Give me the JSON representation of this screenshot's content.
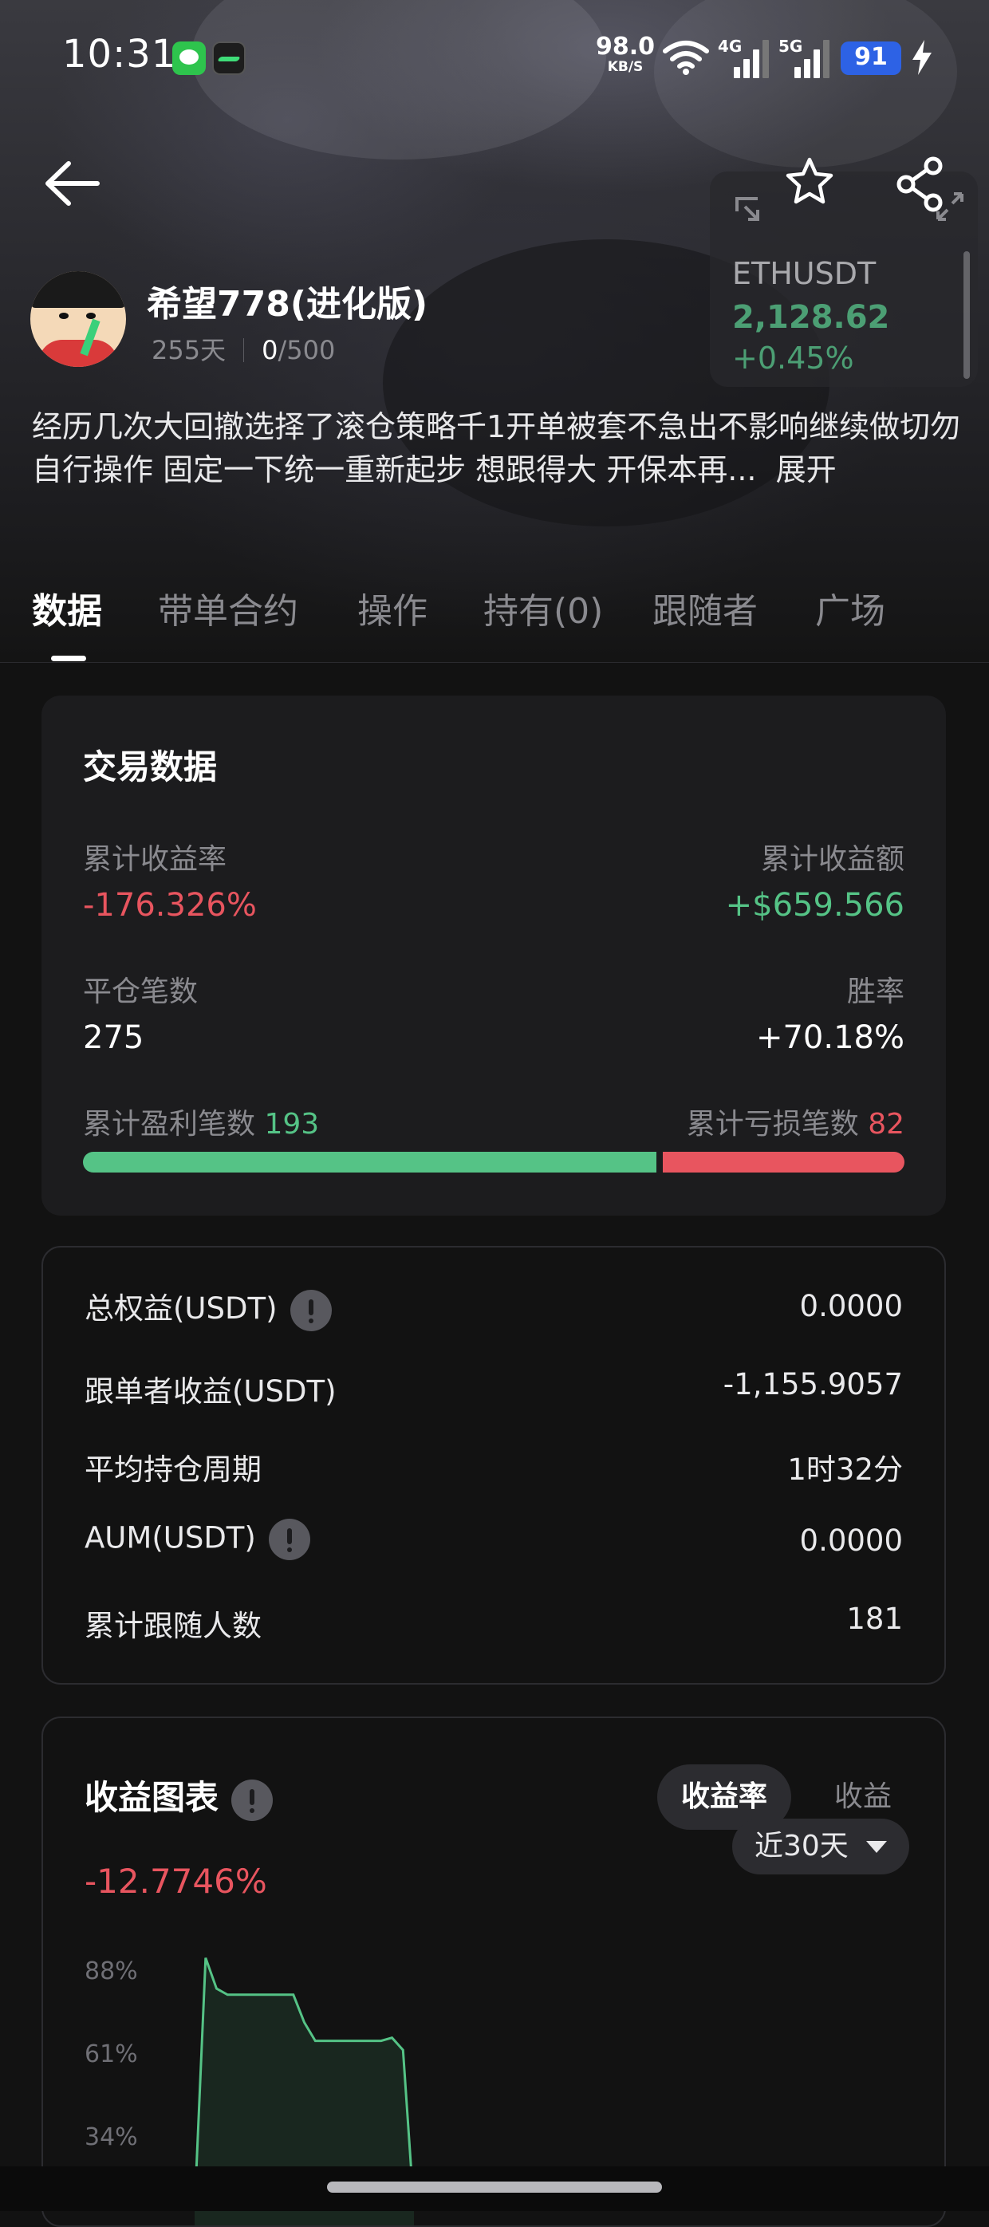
{
  "status_bar": {
    "time": "10:31",
    "net_speed": "98.0",
    "net_unit": "KB/S",
    "sig1_label": "4G",
    "sig2_label": "5G",
    "battery": "91"
  },
  "ticker": {
    "symbol": "ETHUSDT",
    "price": "2,128.62",
    "change": "+0.45%"
  },
  "profile": {
    "name": "希望778(进化版)",
    "days": "255天",
    "followers_current": "0",
    "followers_max": "/500",
    "bio": "经历几次大回撤选择了滚仓策略千1开单被套不急出不影响继续做切勿自行操作 固定一下统一重新起步 想跟得大 开保本再...",
    "bio_more": "展开"
  },
  "tabs": [
    "数据",
    "带单合约",
    "操作",
    "持有(0)",
    "跟随者",
    "广场"
  ],
  "trade_data": {
    "title": "交易数据",
    "cum_rate_label": "累计收益率",
    "cum_rate_value": "-176.326%",
    "cum_amount_label": "累计收益额",
    "cum_amount_value": "+$659.566",
    "closed_label": "平仓笔数",
    "closed_value": "275",
    "win_label": "胜率",
    "win_value": "+70.18%",
    "profit_count_label": "累计盈利笔数",
    "profit_count": "193",
    "loss_count_label": "累计亏损笔数",
    "loss_count": "82",
    "profit_fraction": 0.7018
  },
  "stats": [
    {
      "label": "总权益(USDT)",
      "value": "0.0000",
      "info": true
    },
    {
      "label": "跟单者收益(USDT)",
      "value": "-1,155.9057",
      "info": false
    },
    {
      "label": "平均持仓周期",
      "value": "1时32分",
      "info": false
    },
    {
      "label": "AUM(USDT)",
      "value": "0.0000",
      "info": true
    },
    {
      "label": "累计跟随人数",
      "value": "181",
      "info": false
    }
  ],
  "profit_chart": {
    "title": "收益图表",
    "seg_on": "收益率",
    "seg_off": "收益",
    "current_value": "-12.7746%",
    "range": "近30天"
  },
  "chart_data": {
    "type": "area",
    "title": "收益图表",
    "y_tick_labels": [
      "88%",
      "61%",
      "34%"
    ],
    "ylim": [
      34,
      88
    ],
    "x": [
      0,
      1,
      2,
      3,
      4,
      5,
      6,
      7,
      8,
      9,
      10,
      11,
      12,
      13,
      14,
      15,
      16,
      17,
      18,
      19,
      20
    ],
    "values": [
      10,
      92,
      82,
      80,
      80,
      80,
      80,
      80,
      80,
      80,
      71,
      65,
      65,
      65,
      65,
      65,
      65,
      65,
      66,
      62,
      10
    ],
    "line_color": "#55c386"
  },
  "colors": {
    "positive": "#55c386",
    "negative": "#e8555f",
    "accent_battery": "#2d62e5"
  }
}
